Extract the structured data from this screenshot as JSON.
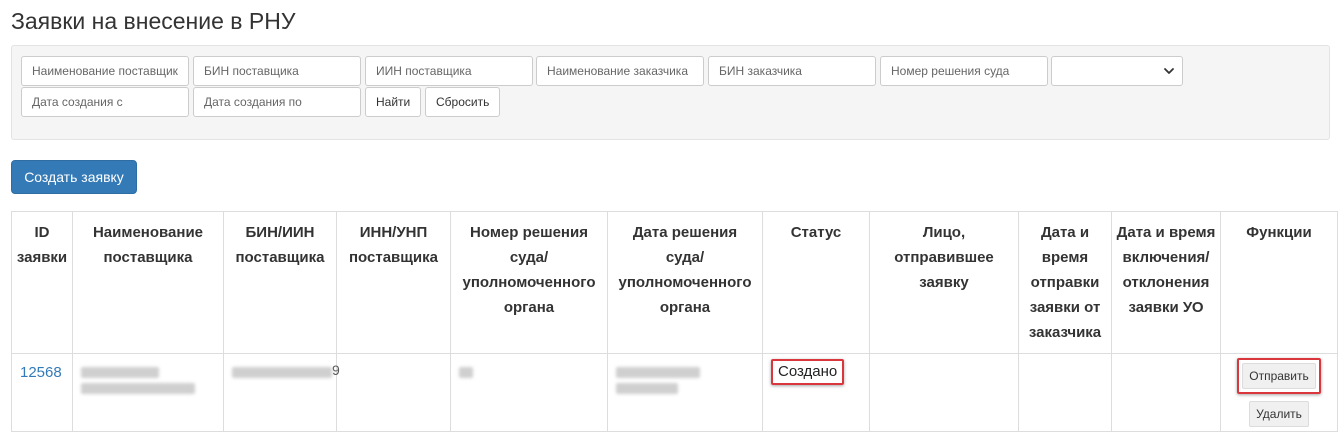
{
  "page": {
    "title": "Заявки на внесение в РНУ"
  },
  "filters": {
    "supplier_name": {
      "placeholder": "Наименование поставщик",
      "value": ""
    },
    "supplier_bin": {
      "placeholder": "БИН поставщика",
      "value": ""
    },
    "supplier_iin": {
      "placeholder": "ИИН поставщика",
      "value": ""
    },
    "customer_name": {
      "placeholder": "Наименование заказчика",
      "value": ""
    },
    "customer_bin": {
      "placeholder": "БИН заказчика",
      "value": ""
    },
    "court_decision_number": {
      "placeholder": "Номер решения суда",
      "value": ""
    },
    "status_select": {
      "selected": ""
    },
    "created_from": {
      "placeholder": "Дата создания с",
      "value": ""
    },
    "created_to": {
      "placeholder": "Дата создания по",
      "value": ""
    },
    "find_label": "Найти",
    "reset_label": "Сбросить"
  },
  "create_button_label": "Создать заявку",
  "table": {
    "columns": [
      "ID заявки",
      "Наименование поставщика",
      "БИН/ИИН поставщика",
      "ИНН/УНП поставщика",
      "Номер решения суда/ уполномоченного органа",
      "Дата решения суда/ уполномоченного органа",
      "Статус",
      "Лицо, отправившее заявку",
      "Дата и время отправки заявки от заказчика",
      "Дата и время включения/ отклонения заявки УО",
      "Функции"
    ],
    "rows": [
      {
        "id": "12568",
        "bin_tail": "9",
        "status": "Создано",
        "sender": "",
        "sent_at": "",
        "decided_at": "",
        "actions": {
          "send": "Отправить",
          "delete": "Удалить"
        }
      }
    ]
  },
  "colors": {
    "primary": "#337ab7",
    "link": "#337ab7",
    "highlight": "#d9363e",
    "panel_bg": "#f5f5f5"
  },
  "icons": {
    "select_arrow": "chevron-down-icon"
  }
}
